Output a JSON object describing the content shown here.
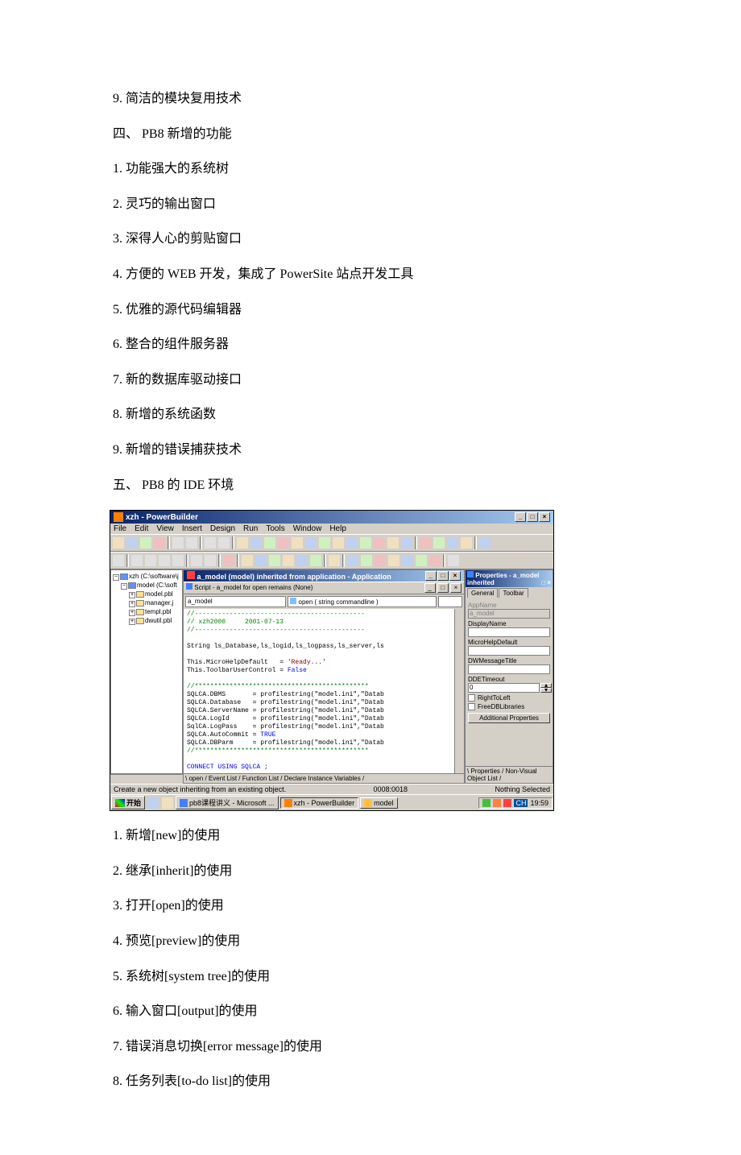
{
  "doc": {
    "p1": "9. 简洁的模块复用技术",
    "p2": "四、 PB8 新增的功能",
    "p3": "1. 功能强大的系统树",
    "p4": "2. 灵巧的输出窗口",
    "p5": "3. 深得人心的剪贴窗口",
    "p6": "4. 方便的 WEB 开发，集成了 PowerSite 站点开发工具",
    "p7": "5. 优雅的源代码编辑器",
    "p8": "6. 整合的组件服务器",
    "p9": "7. 新的数据库驱动接口",
    "p10": "8. 新增的系统函数",
    "p11": "9. 新增的错误捕获技术",
    "p12": "五、 PB8 的 IDE 环境",
    "p13": "1. 新增[new]的使用",
    "p14": "2. 继承[inherit]的使用",
    "p15": "3. 打开[open]的使用",
    "p16": "4. 预览[preview]的使用",
    "p17": "5. 系统树[system tree]的使用",
    "p18": "6. 输入窗口[output]的使用",
    "p19": "7. 错误消息切换[error message]的使用",
    "p20": "8. 任务列表[to-do list]的使用"
  },
  "pb": {
    "title": "xzh - PowerBuilder",
    "menus": [
      "File",
      "Edit",
      "View",
      "Insert",
      "Design",
      "Run",
      "Tools",
      "Window",
      "Help"
    ],
    "tree": {
      "root": "xzh (C:\\software\\j",
      "n1": "model (C:\\soft",
      "n2": "model.pbl",
      "n3": "manager.j",
      "n4": "templ.pbl",
      "n5": "dwutil.pbl"
    },
    "center_title": "a_model (model) inherited from application - Application",
    "script_sub": "Script - a_model for open remains (None)",
    "dd_obj": "a_model",
    "dd_evt": "open ( string commandline )",
    "code": {
      "l1": "//--------------------------------------------",
      "l2": "// xzh2000     2001-07-13",
      "l3": "//--------------------------------------------",
      "l4": "",
      "l5": "String ls_Database,ls_logid,ls_logpass,ls_server,ls",
      "l6": "",
      "l7a": "This.MicroHelpDefault   = ",
      "l7b": "'Ready...'",
      "l8a": "This.ToolbarUserControl = ",
      "l8b": "False",
      "l9": "",
      "l10": "//*********************************************",
      "l11": "SQLCA.DBMS       = profilestring(\"model.ini\",\"Datab",
      "l12": "SQLCA.Database   = profilestring(\"model.ini\",\"Datab",
      "l13": "SQLCA.ServerName = profilestring(\"model.ini\",\"Datab",
      "l14": "SQLCA.LogId      = profilestring(\"model.ini\",\"Datab",
      "l15": "SqlCA.LogPass    = profilestring(\"model.ini\",\"Datab",
      "l16a": "SQLCA.AutoCommit = ",
      "l16b": "TRUE",
      "l17": "SQLCA.DBParm     = profilestring(\"model.ini\",\"Datab",
      "l18": "//*********************************************",
      "l19": "",
      "l20": "CONNECT USING SQLCA ;"
    },
    "tabs_bottom": "\\ open / Event List / Function List / Declare Instance Variables /",
    "prop_title": "Properties - a_model inherited",
    "prop_tabs": {
      "t1": "General",
      "t2": "Toolbar"
    },
    "prop": {
      "appname_lbl": "AppName",
      "appname_val": "a_model",
      "displayname_lbl": "DisplayName",
      "microhelp_lbl": "MicroHelpDefault",
      "dwmsg_lbl": "DWMessageTitle",
      "dde_lbl": "DDETimeout",
      "dde_val": "0",
      "rtl": "RightToLeft",
      "fdl": "FreeDBLibraries",
      "addl": "Additional Properties"
    },
    "prop_tabs_bottom": "\\ Properties / Non-Visual Object List /",
    "status_left": "Create a new object inheriting from an existing object.",
    "status_mid": "0008:0018",
    "status_right": "Nothing Selected",
    "taskbar": {
      "start": "开始",
      "item1": "pb8课程讲义 - Microsoft ...",
      "item2": "xzh - PowerBuilder",
      "item3": "model",
      "lang": "CH",
      "time": "19:59"
    }
  }
}
